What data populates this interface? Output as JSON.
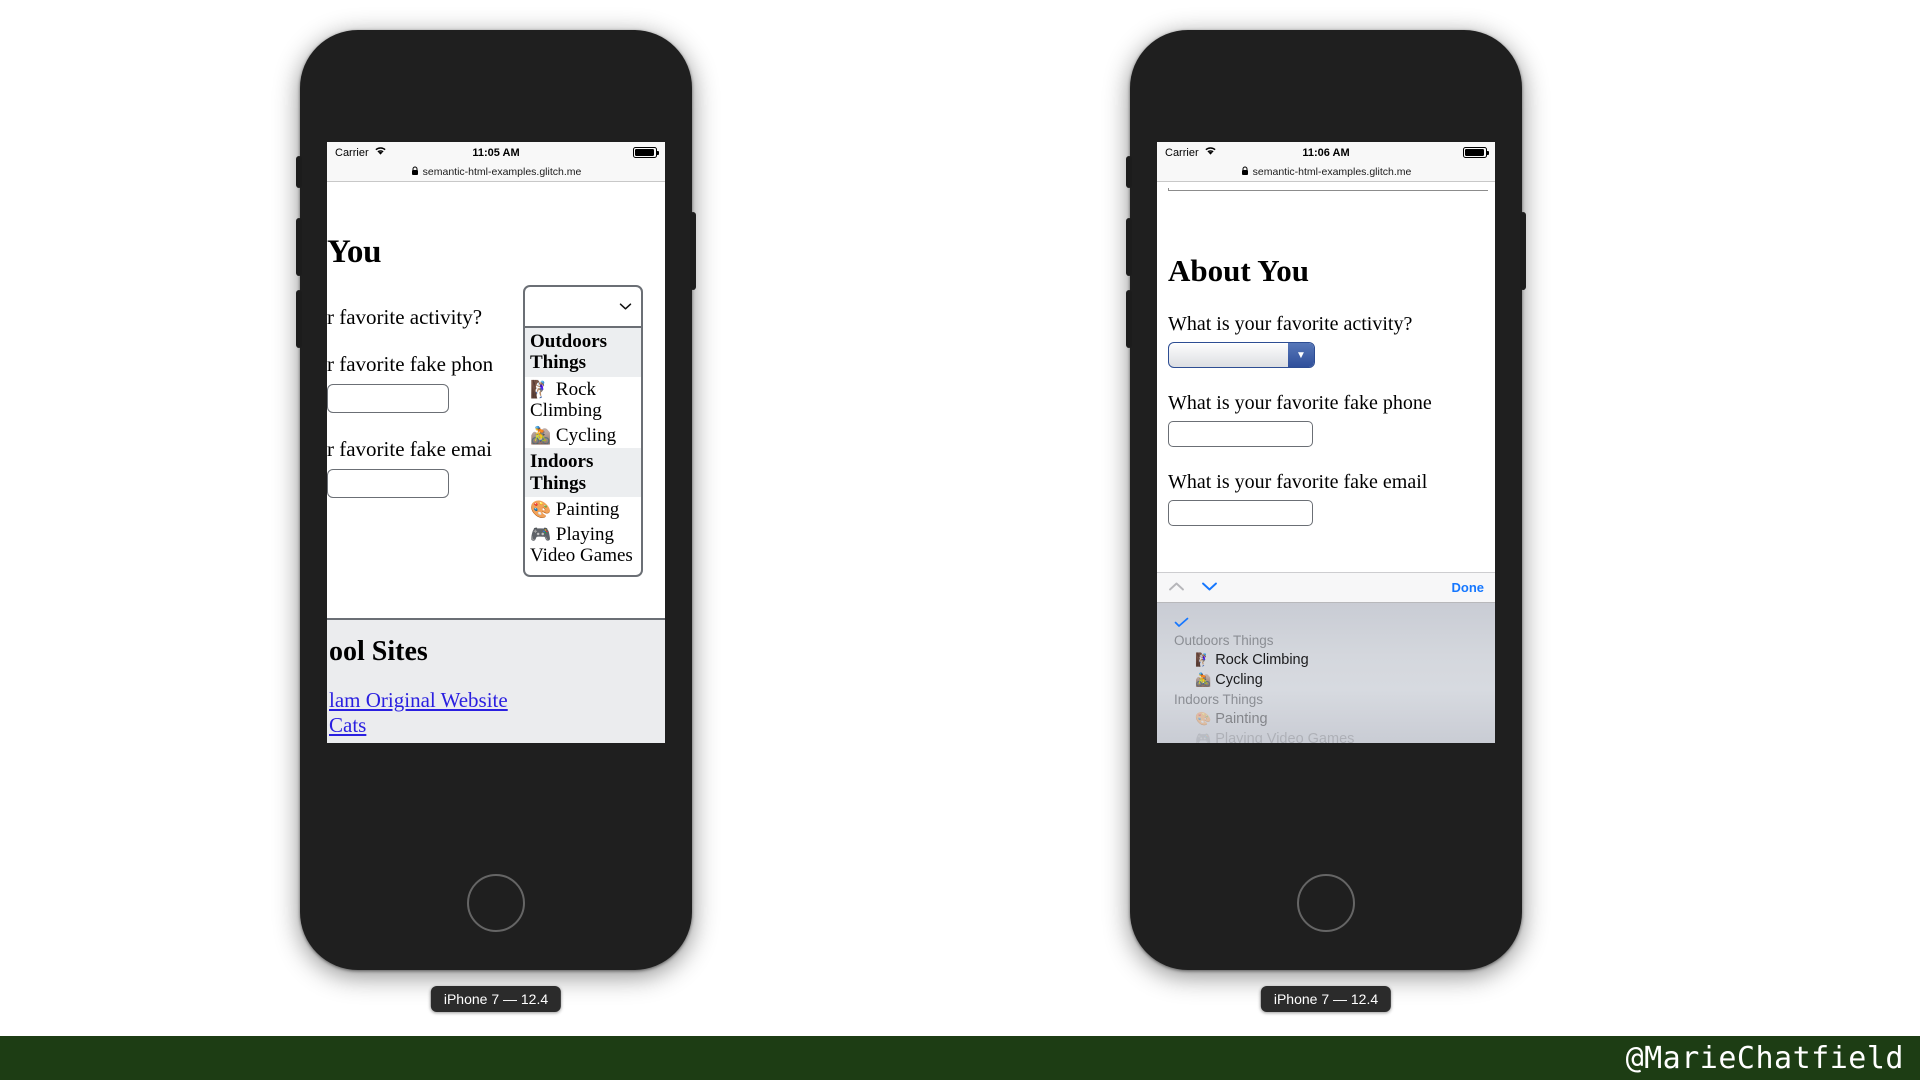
{
  "watermark": {
    "handle": "@MarieChatfield"
  },
  "phones": [
    {
      "id": "left",
      "device_label": "iPhone 7 — 12.4",
      "status_bar": {
        "carrier": "Carrier",
        "time": "11:05 AM",
        "wifi_icon": "wifi-icon",
        "battery_icon": "battery-icon"
      },
      "url_bar": {
        "lock_icon": "lock-icon",
        "url": "semantic-html-examples.glitch.me"
      },
      "page": {
        "heading": "You",
        "questions": [
          "r favorite activity?",
          "r favorite fake phon",
          "r favorite fake emai"
        ],
        "cool_sites": {
          "title": "ool Sites",
          "links": [
            "lam Original Website",
            "Cats"
          ]
        }
      },
      "dropdown": {
        "selected_value": "",
        "chevron_icon": "chevron-down-icon",
        "groups": [
          {
            "label": "Outdoors Things",
            "options": [
              {
                "emoji": "🧗🏽‍♀️",
                "label": "Rock Climbing"
              },
              {
                "emoji": "🚵",
                "label": "Cycling"
              }
            ]
          },
          {
            "label": "Indoors Things",
            "options": [
              {
                "emoji": "🎨",
                "label": "Painting"
              },
              {
                "emoji": "🎮",
                "label": "Playing Video Games"
              }
            ]
          }
        ]
      }
    },
    {
      "id": "right",
      "device_label": "iPhone 7 — 12.4",
      "status_bar": {
        "carrier": "Carrier",
        "time": "11:06 AM",
        "wifi_icon": "wifi-icon",
        "battery_icon": "battery-icon"
      },
      "url_bar": {
        "lock_icon": "lock-icon",
        "url": "semantic-html-examples.glitch.me"
      },
      "page": {
        "heading": "About You",
        "questions": [
          "What is your favorite activity?",
          "What is your favorite fake phone",
          "What is your favorite fake email"
        ],
        "select_value": "",
        "select_arrow_icon": "triangle-down-icon",
        "phone_input_value": "",
        "email_input_value": ""
      },
      "picker": {
        "prev_icon": "chevron-up-icon",
        "next_icon": "chevron-down-icon",
        "done_label": "Done",
        "check_icon": "checkmark-icon",
        "groups": [
          {
            "label": "Outdoors Things",
            "options": [
              {
                "emoji": "🧗🏽‍♀️",
                "label": "Rock Climbing"
              },
              {
                "emoji": "🚵",
                "label": "Cycling"
              }
            ]
          },
          {
            "label": "Indoors Things",
            "options": [
              {
                "emoji": "🎨",
                "label": "Painting"
              },
              {
                "emoji": "🎮",
                "label": "Playing Video Games"
              }
            ]
          }
        ]
      }
    }
  ]
}
